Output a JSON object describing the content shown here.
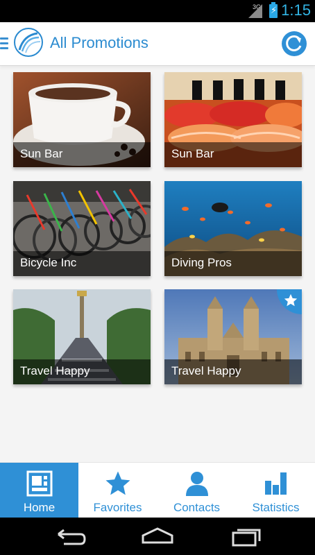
{
  "status_bar": {
    "network": "3G",
    "time": "1:15",
    "battery_charging": true
  },
  "app_bar": {
    "title": "All Promotions",
    "menu_icon": "hamburger-icon",
    "logo_icon": "brand-logo",
    "refresh_icon": "refresh-icon"
  },
  "promotions": [
    {
      "label": "Sun Bar",
      "image": "coffee-cup-photo",
      "favorite": false
    },
    {
      "label": "Sun Bar",
      "image": "sushi-photo",
      "favorite": false
    },
    {
      "label": "Bicycle Inc",
      "image": "bicycles-photo",
      "favorite": false
    },
    {
      "label": "Diving Pros",
      "image": "coral-reef-photo",
      "favorite": false
    },
    {
      "label": "Travel Happy",
      "image": "city-crowd-photo",
      "favorite": false
    },
    {
      "label": "Travel Happy",
      "image": "cathedral-photo",
      "favorite": true
    }
  ],
  "bottom_nav": [
    {
      "label": "Home",
      "icon": "home-grid-icon",
      "active": true
    },
    {
      "label": "Favorites",
      "icon": "star-icon",
      "active": false
    },
    {
      "label": "Contacts",
      "icon": "person-icon",
      "active": false
    },
    {
      "label": "Statistics",
      "icon": "bar-chart-icon",
      "active": false
    }
  ],
  "system_nav": [
    "back-icon",
    "home-icon",
    "recents-icon"
  ],
  "colors": {
    "accent": "#2f90d6",
    "status_time": "#33b5e5",
    "background": "#f4f4f4"
  }
}
